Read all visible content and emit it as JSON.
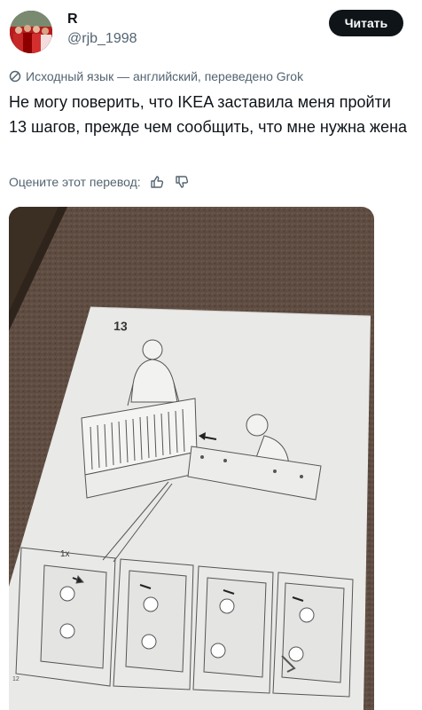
{
  "author": {
    "name": "R",
    "handle": "@rjb_1998"
  },
  "actions": {
    "read_label": "Читать"
  },
  "translation": {
    "note": "Исходный язык — английский, переведено Grok",
    "rate_label": "Оцените этот перевод:"
  },
  "post": {
    "text": "Не могу поверить, что IKEA заставила меня пройти 13 шагов, прежде чем сообщить, что мне нужна жена"
  },
  "photo": {
    "step_number": "13",
    "detail_quantity": "1x",
    "page_number": "12"
  },
  "colors": {
    "text_primary": "#0f1419",
    "text_secondary": "#536471",
    "button_bg": "#0f1419",
    "carpet": "#5b4a40",
    "paper": "#e9e9e7"
  },
  "icons": {
    "translate": "slashed-circle-icon",
    "like": "thumbs-up-icon",
    "dislike": "thumbs-down-icon"
  }
}
